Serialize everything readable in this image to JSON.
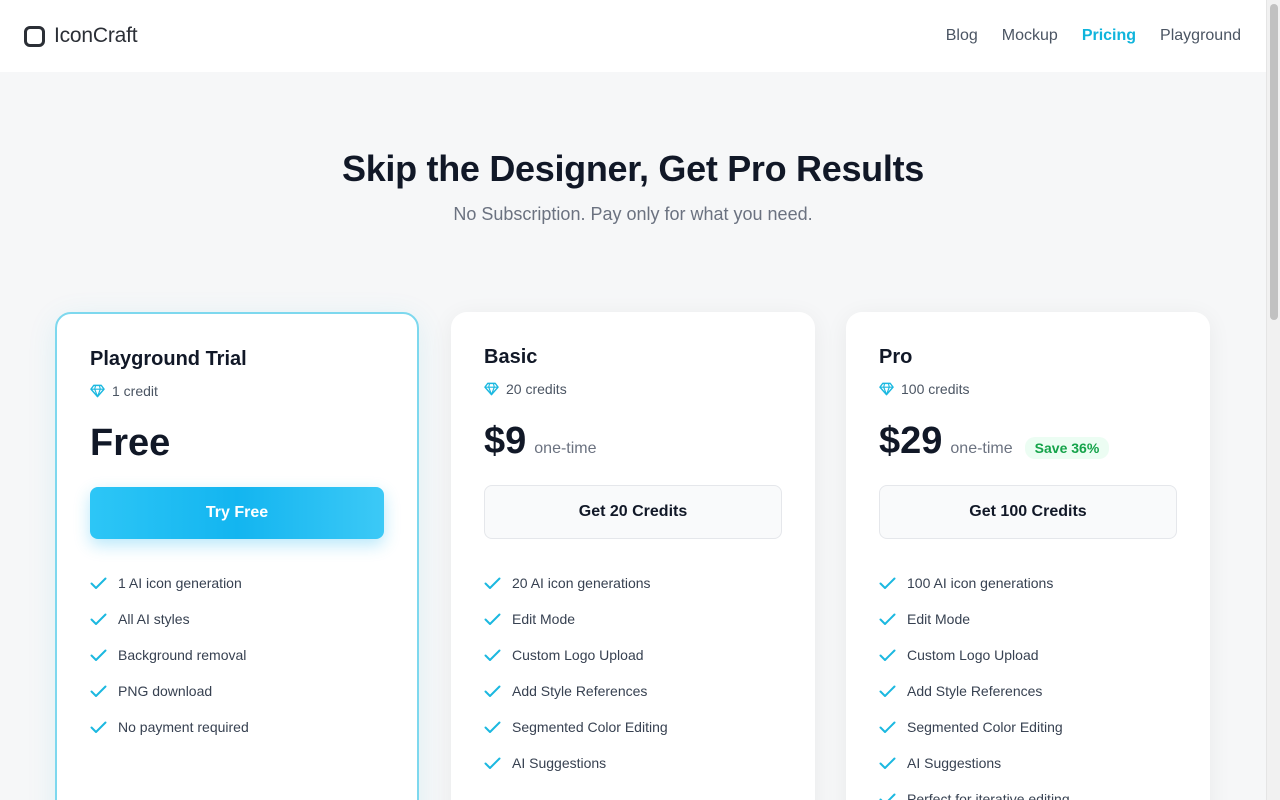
{
  "header": {
    "brand": "IconCraft",
    "nav": [
      {
        "label": "Blog",
        "active": false
      },
      {
        "label": "Mockup",
        "active": false
      },
      {
        "label": "Pricing",
        "active": true
      },
      {
        "label": "Playground",
        "active": false
      }
    ]
  },
  "hero": {
    "title": "Skip the Designer, Get Pro Results",
    "subtitle": "No Subscription. Pay only for what you need."
  },
  "plans": [
    {
      "name": "Playground Trial",
      "credits": "1 credit",
      "price": "Free",
      "period": "",
      "badge": "",
      "cta": "Try Free",
      "features": [
        "1 AI icon generation",
        "All AI styles",
        "Background removal",
        "PNG download",
        "No payment required"
      ]
    },
    {
      "name": "Basic",
      "credits": "20 credits",
      "price": "$9",
      "period": "one-time",
      "badge": "",
      "cta": "Get 20 Credits",
      "features": [
        "20 AI icon generations",
        "Edit Mode",
        "Custom Logo Upload",
        "Add Style References",
        "Segmented Color Editing",
        "AI Suggestions"
      ]
    },
    {
      "name": "Pro",
      "credits": "100 credits",
      "price": "$29",
      "period": "one-time",
      "badge": "Save 36%",
      "cta": "Get 100 Credits",
      "features": [
        "100 AI icon generations",
        "Edit Mode",
        "Custom Logo Upload",
        "Add Style References",
        "Segmented Color Editing",
        "AI Suggestions",
        "Perfect for iterative editing"
      ]
    }
  ],
  "colors": {
    "accent": "#0fb4dc",
    "check": "#1bb8e0",
    "save_badge_text": "#15a34a",
    "save_badge_bg": "#ecfdf3"
  }
}
